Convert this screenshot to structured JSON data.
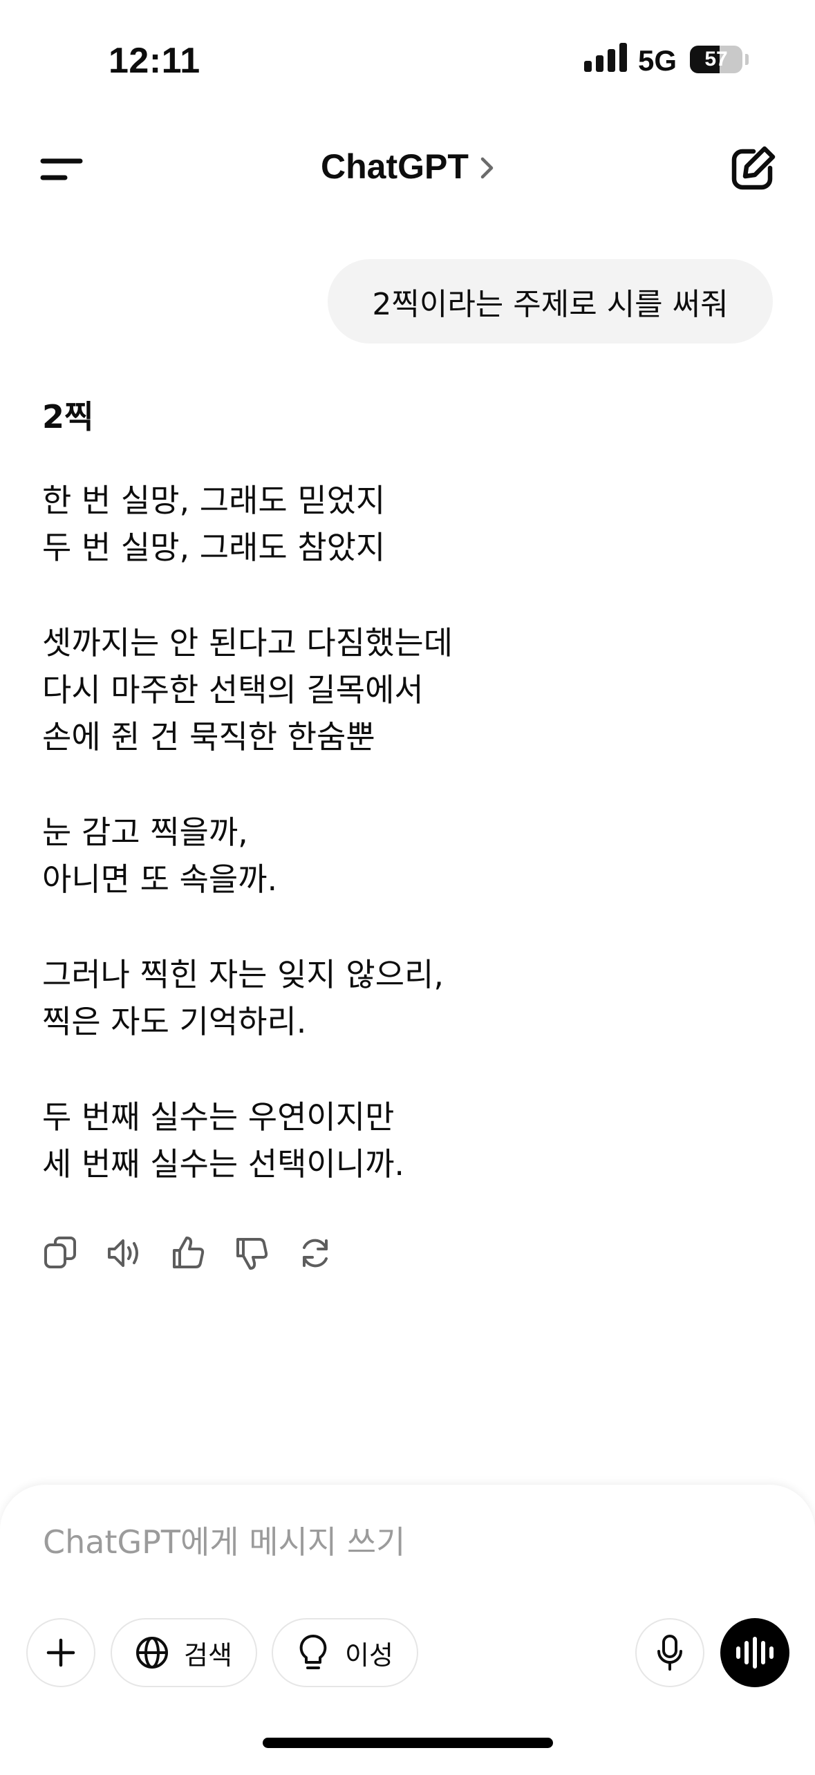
{
  "status_bar": {
    "time": "12:11",
    "network": "5G",
    "battery_level": "57",
    "battery_fraction": 0.57
  },
  "header": {
    "title": "ChatGPT",
    "menu_icon": "menu-icon",
    "title_chevron_icon": "chevron-right-icon",
    "compose_icon": "new-chat-icon"
  },
  "conversation": {
    "user_message": "2찍이라는 주제로 시를 써줘",
    "assistant": {
      "title": "2찍",
      "stanzas": [
        [
          "한 번 실망, 그래도 믿었지",
          "두 번 실망, 그래도 참았지"
        ],
        [
          "셋까지는 안 된다고 다짐했는데",
          "다시 마주한 선택의 길목에서",
          "손에 쥔 건 묵직한 한숨뿐"
        ],
        [
          "눈 감고 찍을까,",
          "아니면 또 속을까."
        ],
        [
          "그러나 찍힌 자는 잊지 않으리,",
          "찍은 자도 기억하리."
        ],
        [
          "두 번째 실수는 우연이지만",
          "세 번째 실수는 선택이니까."
        ]
      ]
    },
    "actions": [
      "copy-icon",
      "read-aloud-icon",
      "thumbs-up-icon",
      "thumbs-down-icon",
      "regenerate-icon"
    ]
  },
  "composer": {
    "placeholder": "ChatGPT에게 메시지 쓰기",
    "value": "",
    "search_label": "검색",
    "reason_label": "이성",
    "icons": [
      "plus-icon",
      "globe-icon",
      "lightbulb-icon",
      "microphone-icon",
      "voice-mode-icon"
    ]
  },
  "colors": {
    "bubble_bg": "#f3f3f3",
    "text": "#0d0d0d",
    "placeholder": "#9b9b9b",
    "icon": "#5d5d5d"
  }
}
